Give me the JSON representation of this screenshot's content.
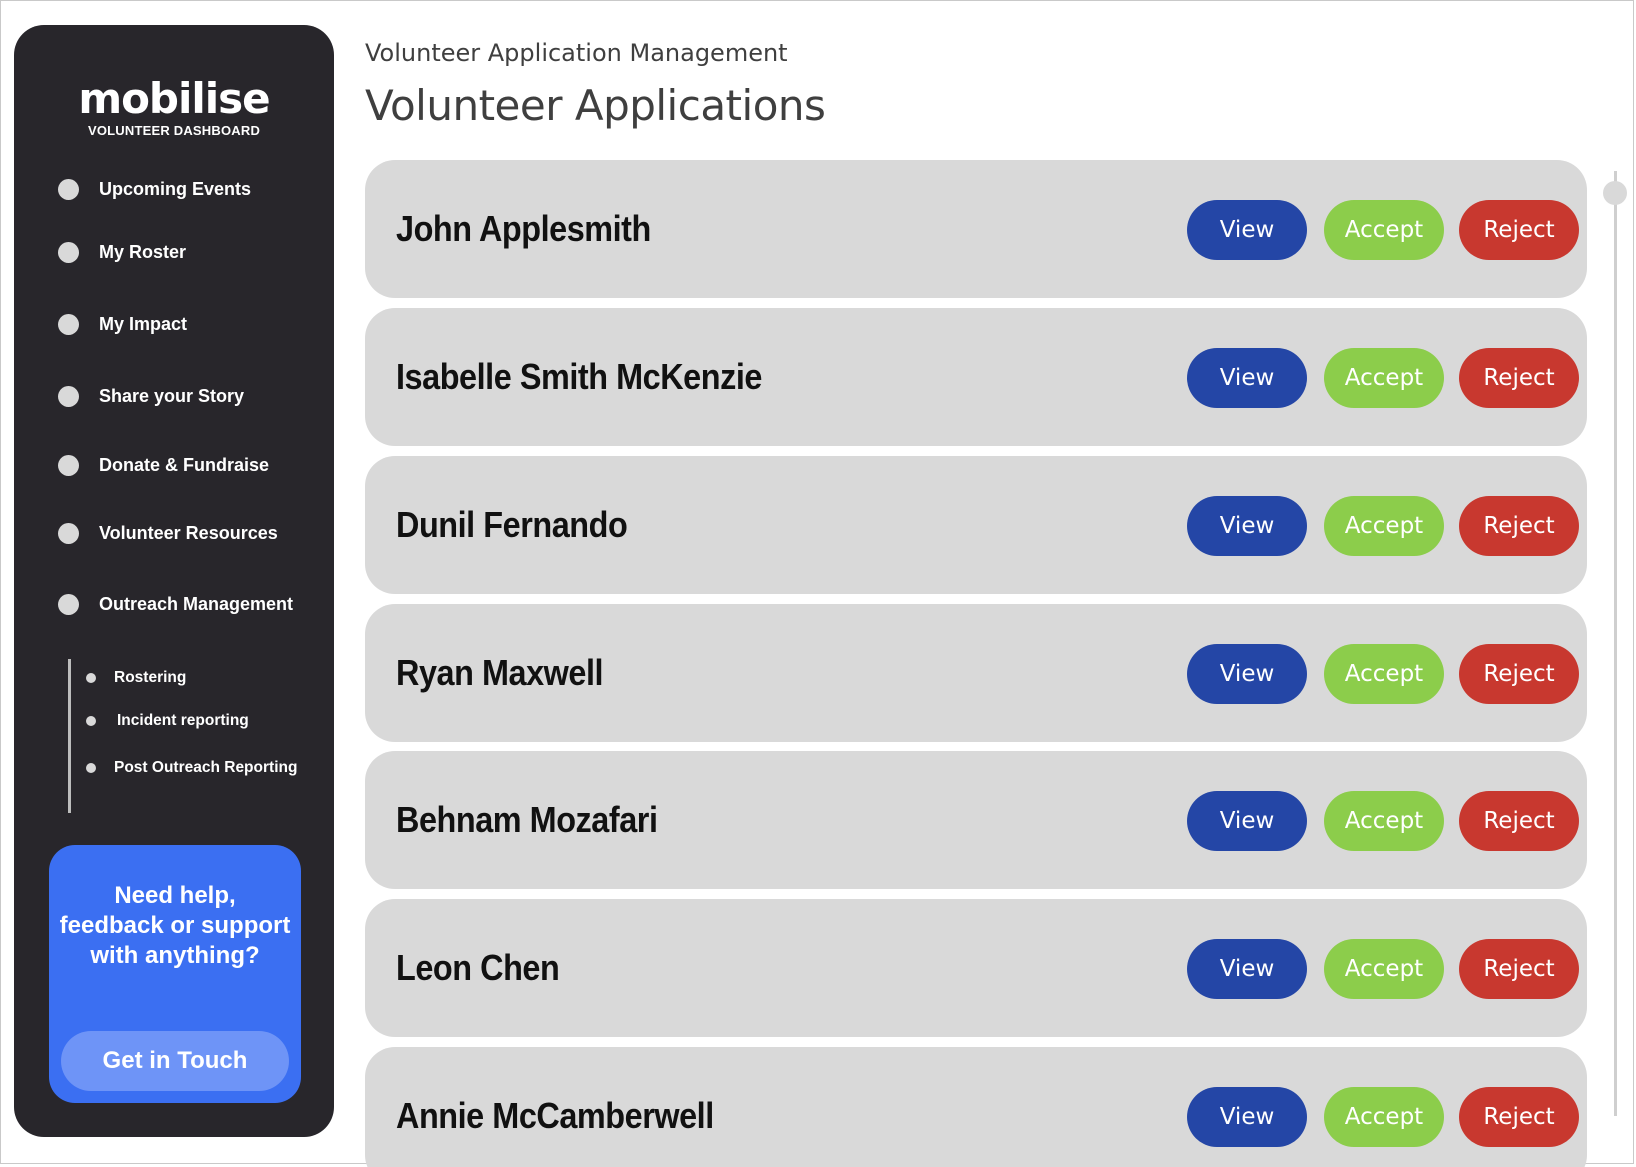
{
  "sidebar": {
    "logo_text": "mobilise",
    "logo_subtitle": "VOLUNTEER DASHBOARD",
    "items": [
      {
        "label": "Upcoming Events"
      },
      {
        "label": "My Roster"
      },
      {
        "label": "My Impact"
      },
      {
        "label": "Share your Story"
      },
      {
        "label": "Donate & Fundraise"
      },
      {
        "label": "Volunteer Resources"
      },
      {
        "label": "Outreach Management"
      }
    ],
    "sub_items": [
      {
        "label": "Rostering"
      },
      {
        "label": "Incident reporting"
      },
      {
        "label": "Post Outreach Reporting"
      }
    ],
    "help": {
      "text": "Need help, feedback or support with anything?",
      "button_label": "Get in Touch"
    }
  },
  "header": {
    "breadcrumb": "Volunteer Application Management",
    "title": "Volunteer Applications"
  },
  "applications": [
    {
      "name": "John Applesmith"
    },
    {
      "name": "Isabelle Smith McKenzie"
    },
    {
      "name": "Dunil Fernando"
    },
    {
      "name": "Ryan Maxwell"
    },
    {
      "name": "Behnam Mozafari"
    },
    {
      "name": "Leon Chen"
    },
    {
      "name": "Annie McCamberwell"
    }
  ],
  "actions": {
    "view_label": "View",
    "accept_label": "Accept",
    "reject_label": "Reject"
  },
  "colors": {
    "sidebar_bg": "#28262b",
    "help_card": "#3b6ff2",
    "view": "#2446a6",
    "accept": "#8ccd4b",
    "reject": "#c8382f",
    "row_bg": "#d9d9d9"
  }
}
